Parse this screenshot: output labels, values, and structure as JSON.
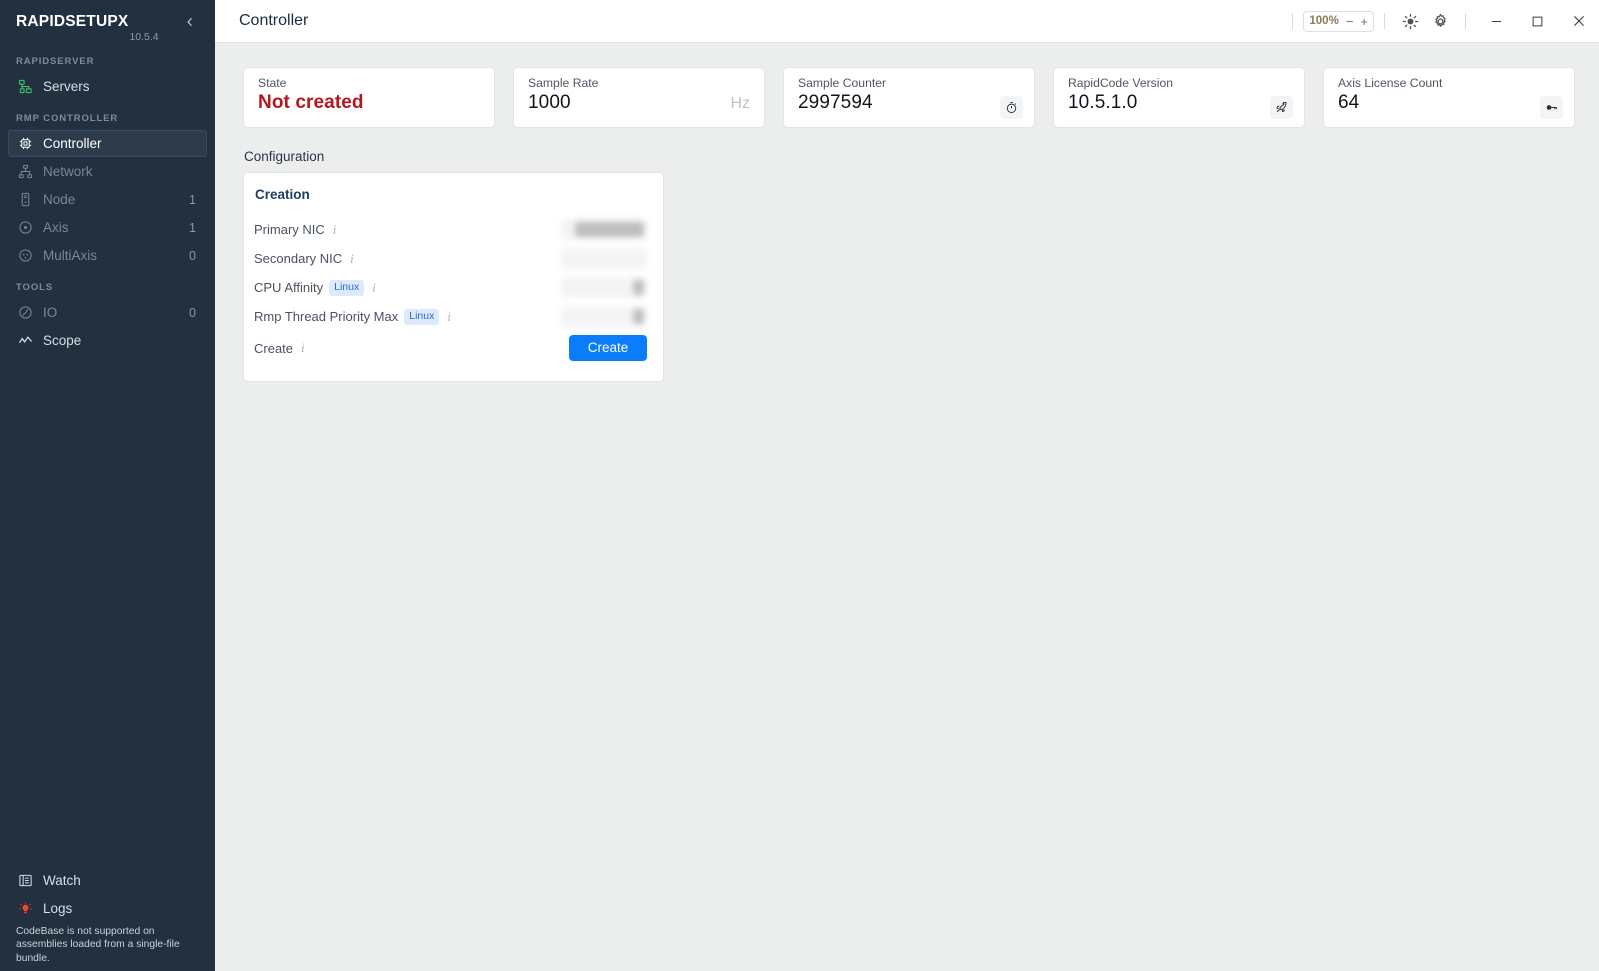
{
  "sidebar": {
    "brand": {
      "name": "RAPIDSETUPX",
      "version": "10.5.4",
      "collapse_icon": "chevron-left-icon"
    },
    "groups": [
      {
        "label": "RAPIDSERVER",
        "items": [
          {
            "label": "Servers",
            "icon": "servers-icon",
            "count": "",
            "state": "normal",
            "accent": "#3fbf6a"
          }
        ]
      },
      {
        "label": "RMP CONTROLLER",
        "items": [
          {
            "label": "Controller",
            "icon": "chip-icon",
            "count": "",
            "state": "active"
          },
          {
            "label": "Network",
            "icon": "network-icon",
            "count": "",
            "state": "disabled"
          },
          {
            "label": "Node",
            "icon": "node-icon",
            "count": "1",
            "state": "disabled"
          },
          {
            "label": "Axis",
            "icon": "axis-icon",
            "count": "1",
            "state": "disabled"
          },
          {
            "label": "MultiAxis",
            "icon": "multiaxis-icon",
            "count": "0",
            "state": "disabled"
          }
        ]
      },
      {
        "label": "TOOLS",
        "items": [
          {
            "label": "IO",
            "icon": "io-icon",
            "count": "0",
            "state": "disabled"
          },
          {
            "label": "Scope",
            "icon": "scope-icon",
            "count": "",
            "state": "normal"
          }
        ]
      }
    ],
    "bottom": [
      {
        "label": "Watch",
        "icon": "watch-list-icon",
        "state": "normal"
      },
      {
        "label": "Logs",
        "icon": "logs-bulb-icon",
        "state": "normal",
        "accent": "#f4462e"
      }
    ],
    "note": "CodeBase is not supported on assemblies loaded from a single-file bundle."
  },
  "titlebar": {
    "title": "Controller",
    "zoom": {
      "value": "100%",
      "minus": "−",
      "plus": "+"
    },
    "icons": [
      {
        "name": "brightness-icon"
      },
      {
        "name": "gear-icon"
      }
    ],
    "window": {
      "minimize": "minimize-icon",
      "maximize": "maximize-icon",
      "close": "close-icon"
    }
  },
  "cards": [
    {
      "label": "State",
      "value": "Not created",
      "unit": "",
      "badge": "",
      "danger": true
    },
    {
      "label": "Sample Rate",
      "value": "1000",
      "unit": "Hz",
      "badge": "",
      "danger": false
    },
    {
      "label": "Sample Counter",
      "value": "2997594",
      "unit": "",
      "badge": "stopwatch-icon",
      "danger": false
    },
    {
      "label": "RapidCode Version",
      "value": "10.5.1.0",
      "unit": "",
      "badge": "rocket-icon",
      "danger": false
    },
    {
      "label": "Axis License Count",
      "value": "64",
      "unit": "",
      "badge": "key-icon",
      "danger": false
    }
  ],
  "configuration": {
    "section_title": "Configuration",
    "panel_title": "Creation",
    "rows": [
      {
        "label": "Primary NIC",
        "badge": "",
        "info": "i",
        "control": "blurred-select",
        "fill": "w-full"
      },
      {
        "label": "Secondary NIC",
        "badge": "",
        "info": "i",
        "control": "blurred-select",
        "fill": "w-none"
      },
      {
        "label": "CPU Affinity",
        "badge": "Linux",
        "info": "i",
        "control": "blurred-input",
        "fill": "w-small"
      },
      {
        "label": "Rmp Thread Priority Max",
        "badge": "Linux",
        "info": "i",
        "control": "blurred-input",
        "fill": "w-small"
      },
      {
        "label": "Create",
        "badge": "",
        "info": "i",
        "control": "button",
        "button_label": "Create"
      }
    ]
  },
  "colors": {
    "sidebar_bg": "#22303f",
    "accent_blue": "#0b7cfb",
    "danger_red": "#b5171d",
    "panel_title": "#1f3f63",
    "badge_linux_bg": "#dceafc",
    "badge_linux_fg": "#2a6bc6",
    "content_bg": "#eceded"
  }
}
